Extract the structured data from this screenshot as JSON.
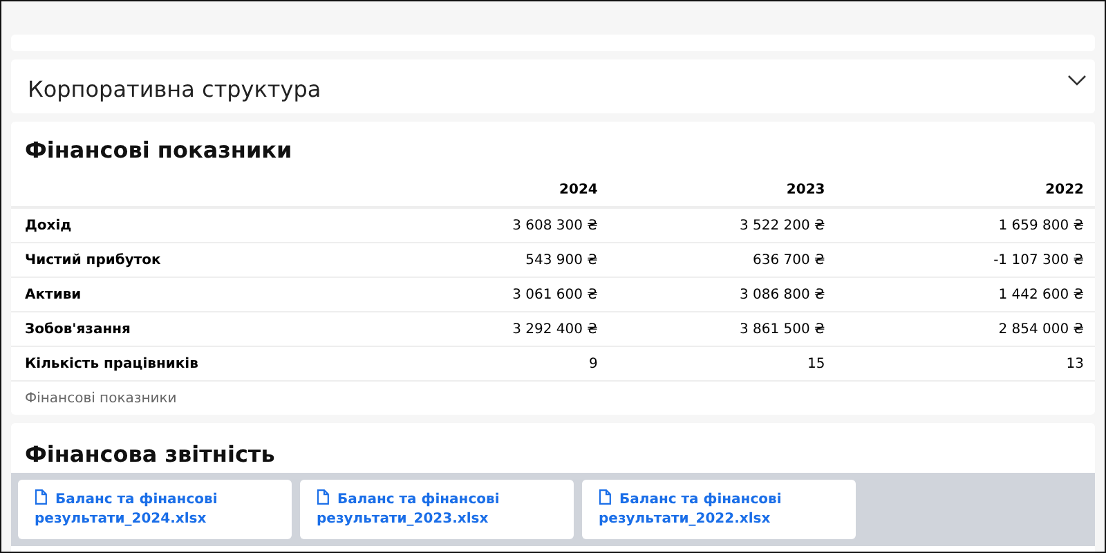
{
  "accordion": {
    "title": "Корпоративна структура",
    "expanded": false
  },
  "financials": {
    "title": "Фінансові показники",
    "columns": [
      "2024",
      "2023",
      "2022"
    ],
    "rows": [
      {
        "label": "Дохід",
        "values": [
          "3 608 300 ₴",
          "3 522 200 ₴",
          "1 659 800 ₴"
        ]
      },
      {
        "label": "Чистий прибуток",
        "values": [
          "543 900 ₴",
          "636 700 ₴",
          "-1 107 300 ₴"
        ]
      },
      {
        "label": "Активи",
        "values": [
          "3 061 600 ₴",
          "3 086 800 ₴",
          "1 442 600 ₴"
        ]
      },
      {
        "label": "Зобов'язання",
        "values": [
          "3 292 400 ₴",
          "3 861 500 ₴",
          "2 854 000 ₴"
        ]
      },
      {
        "label": "Кількість працівників",
        "values": [
          "9",
          "15",
          "13"
        ]
      }
    ],
    "caption": "Фінансові показники"
  },
  "reports": {
    "title": "Фінансова звітність",
    "files": [
      "Баланс та фінансові результати_2024.xlsx",
      "Баланс та фінансові результати_2023.xlsx",
      "Баланс та фінансові результати_2022.xlsx"
    ]
  }
}
